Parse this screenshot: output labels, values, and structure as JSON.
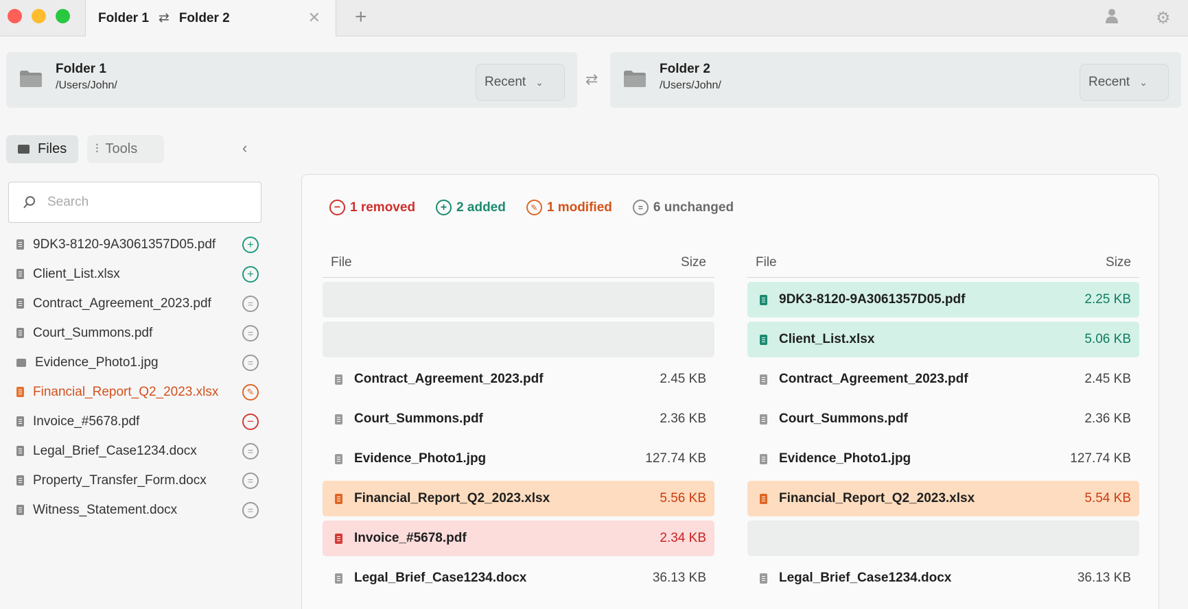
{
  "tab": {
    "left": "Folder 1",
    "right": "Folder 2",
    "swap_icon": "⇄"
  },
  "folders": [
    {
      "title": "Folder 1",
      "path": "/Users/John/",
      "recent_label": "Recent"
    },
    {
      "title": "Folder 2",
      "path": "/Users/John/",
      "recent_label": "Recent"
    }
  ],
  "sidebar": {
    "files_tab": "Files",
    "tools_tab": "Tools",
    "search_placeholder": "Search",
    "items": [
      {
        "name": "9DK3-8120-9A3061357D05.pdf",
        "status": "added",
        "icon": "document-icon"
      },
      {
        "name": "Client_List.xlsx",
        "status": "added",
        "icon": "document-icon"
      },
      {
        "name": "Contract_Agreement_2023.pdf",
        "status": "unchanged",
        "icon": "document-icon"
      },
      {
        "name": "Court_Summons.pdf",
        "status": "unchanged",
        "icon": "document-icon"
      },
      {
        "name": "Evidence_Photo1.jpg",
        "status": "unchanged",
        "icon": "image-icon"
      },
      {
        "name": "Financial_Report_Q2_2023.xlsx",
        "status": "modified",
        "icon": "document-icon"
      },
      {
        "name": "Invoice_#5678.pdf",
        "status": "removed",
        "icon": "document-icon"
      },
      {
        "name": "Legal_Brief_Case1234.docx",
        "status": "unchanged",
        "icon": "document-icon"
      },
      {
        "name": "Property_Transfer_Form.docx",
        "status": "unchanged",
        "icon": "document-icon"
      },
      {
        "name": "Witness_Statement.docx",
        "status": "unchanged",
        "icon": "document-icon"
      }
    ]
  },
  "summary": {
    "removed": "1 removed",
    "added": "2 added",
    "modified": "1 modified",
    "unchanged": "6 unchanged"
  },
  "table_headers": {
    "file": "File",
    "size": "Size"
  },
  "left_table": [
    {
      "name": "",
      "size": "",
      "state": "empty"
    },
    {
      "name": "",
      "size": "",
      "state": "empty"
    },
    {
      "name": "Contract_Agreement_2023.pdf",
      "size": "2.45 KB",
      "state": "unchanged"
    },
    {
      "name": "Court_Summons.pdf",
      "size": "2.36 KB",
      "state": "unchanged"
    },
    {
      "name": "Evidence_Photo1.jpg",
      "size": "127.74 KB",
      "state": "unchanged"
    },
    {
      "name": "Financial_Report_Q2_2023.xlsx",
      "size": "5.56 KB",
      "state": "modified"
    },
    {
      "name": "Invoice_#5678.pdf",
      "size": "2.34 KB",
      "state": "removed"
    },
    {
      "name": "Legal_Brief_Case1234.docx",
      "size": "36.13 KB",
      "state": "unchanged"
    }
  ],
  "right_table": [
    {
      "name": "9DK3-8120-9A3061357D05.pdf",
      "size": "2.25 KB",
      "state": "added"
    },
    {
      "name": "Client_List.xlsx",
      "size": "5.06 KB",
      "state": "added"
    },
    {
      "name": "Contract_Agreement_2023.pdf",
      "size": "2.45 KB",
      "state": "unchanged"
    },
    {
      "name": "Court_Summons.pdf",
      "size": "2.36 KB",
      "state": "unchanged"
    },
    {
      "name": "Evidence_Photo1.jpg",
      "size": "127.74 KB",
      "state": "unchanged"
    },
    {
      "name": "Financial_Report_Q2_2023.xlsx",
      "size": "5.54 KB",
      "state": "modified"
    },
    {
      "name": "",
      "size": "",
      "state": "empty"
    },
    {
      "name": "Legal_Brief_Case1234.docx",
      "size": "36.13 KB",
      "state": "unchanged"
    }
  ],
  "colors": {
    "added": "#1a8a70",
    "removed": "#cf2f2b",
    "modified": "#e06624",
    "unchanged": "#8a8a8a"
  }
}
